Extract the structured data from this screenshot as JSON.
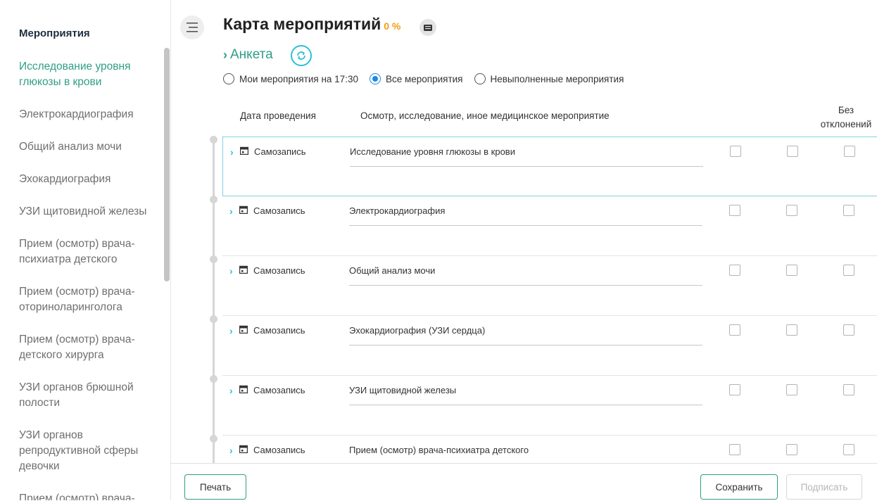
{
  "sidebar": {
    "title": "Мероприятия",
    "items": [
      {
        "label": "Исследование уровня глюкозы в крови",
        "active": true
      },
      {
        "label": "Электрокардиография"
      },
      {
        "label": "Общий анализ мочи"
      },
      {
        "label": "Эхокардиография"
      },
      {
        "label": "УЗИ щитовидной железы"
      },
      {
        "label": "Прием (осмотр) врача-психиатра детского"
      },
      {
        "label": "Прием (осмотр) врача-оториноларинголога"
      },
      {
        "label": "Прием (осмотр) врача-детского хирурга"
      },
      {
        "label": "УЗИ органов брюшной полости"
      },
      {
        "label": "УЗИ органов репродуктивной сферы девочки"
      },
      {
        "label": "Прием (осмотр) врача-"
      }
    ]
  },
  "header": {
    "title": "Карта мероприятий",
    "percent": "0 %",
    "anketa_label": "Анкета"
  },
  "filters": {
    "options": [
      {
        "label": "Мои мероприятия на 17:30",
        "checked": false
      },
      {
        "label": "Все мероприятия",
        "checked": true
      },
      {
        "label": "Невыполненные мероприятия",
        "checked": false
      }
    ]
  },
  "table": {
    "headers": {
      "date": "Дата проведения",
      "event": "Осмотр, исследование, иное медицинское мероприятие",
      "no_deviation_line1": "Без",
      "no_deviation_line2": "отклонений"
    },
    "rows": [
      {
        "date": "Самозапись",
        "event": "Исследование уровня глюкозы в крови"
      },
      {
        "date": "Самозапись",
        "event": "Электрокардиография"
      },
      {
        "date": "Самозапись",
        "event": "Общий анализ мочи"
      },
      {
        "date": "Самозапись",
        "event": "Эхокардиография (УЗИ сердца)"
      },
      {
        "date": "Самозапись",
        "event": "УЗИ щитовидной железы"
      },
      {
        "date": "Самозапись",
        "event": "Прием (осмотр) врача-психиатра детского"
      }
    ]
  },
  "footer": {
    "print_label": "Печать",
    "save_label": "Сохранить",
    "sign_label": "Подписать"
  },
  "colors": {
    "accent": "#2f9e86",
    "active_item": "#2f9e86",
    "percent": "#f39c12",
    "radio_checked": "#1e88e5",
    "refresh_border": "#2dc0d6"
  }
}
